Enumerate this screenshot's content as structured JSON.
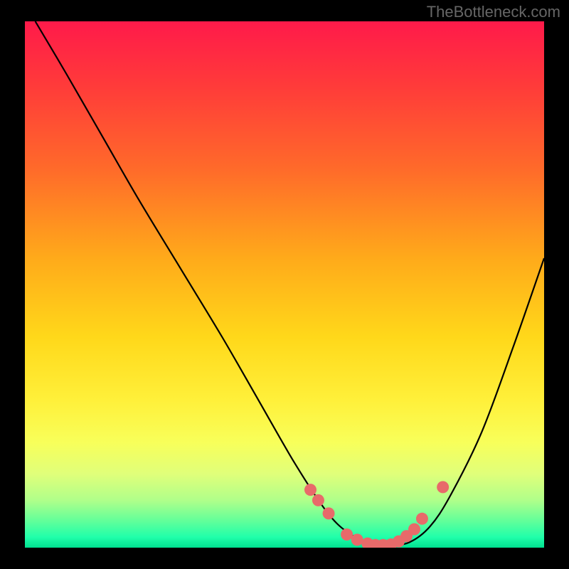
{
  "watermark": "TheBottleneck.com",
  "chart_data": {
    "type": "line",
    "title": "",
    "xlabel": "",
    "ylabel": "",
    "xlim": [
      0,
      100
    ],
    "ylim": [
      0,
      100
    ],
    "curve": {
      "x": [
        2,
        8,
        15,
        22,
        30,
        38,
        45,
        52,
        58,
        62,
        66,
        70,
        74,
        78,
        82,
        88,
        94,
        100
      ],
      "y": [
        100,
        90,
        78,
        66,
        53,
        40,
        28,
        16,
        7,
        3,
        1,
        0.5,
        1,
        4,
        10,
        22,
        38,
        55
      ]
    },
    "markers": {
      "x": [
        55.0,
        56.5,
        58.5,
        62.0,
        64.0,
        66.0,
        67.5,
        69.0,
        70.5,
        72.0,
        73.5,
        75.0,
        76.5,
        80.5
      ],
      "y": [
        11.0,
        9.0,
        6.5,
        2.5,
        1.5,
        0.8,
        0.5,
        0.5,
        0.6,
        1.2,
        2.2,
        3.5,
        5.5,
        11.5
      ]
    },
    "marker_color": "#e86a6a",
    "curve_color": "#000000"
  }
}
